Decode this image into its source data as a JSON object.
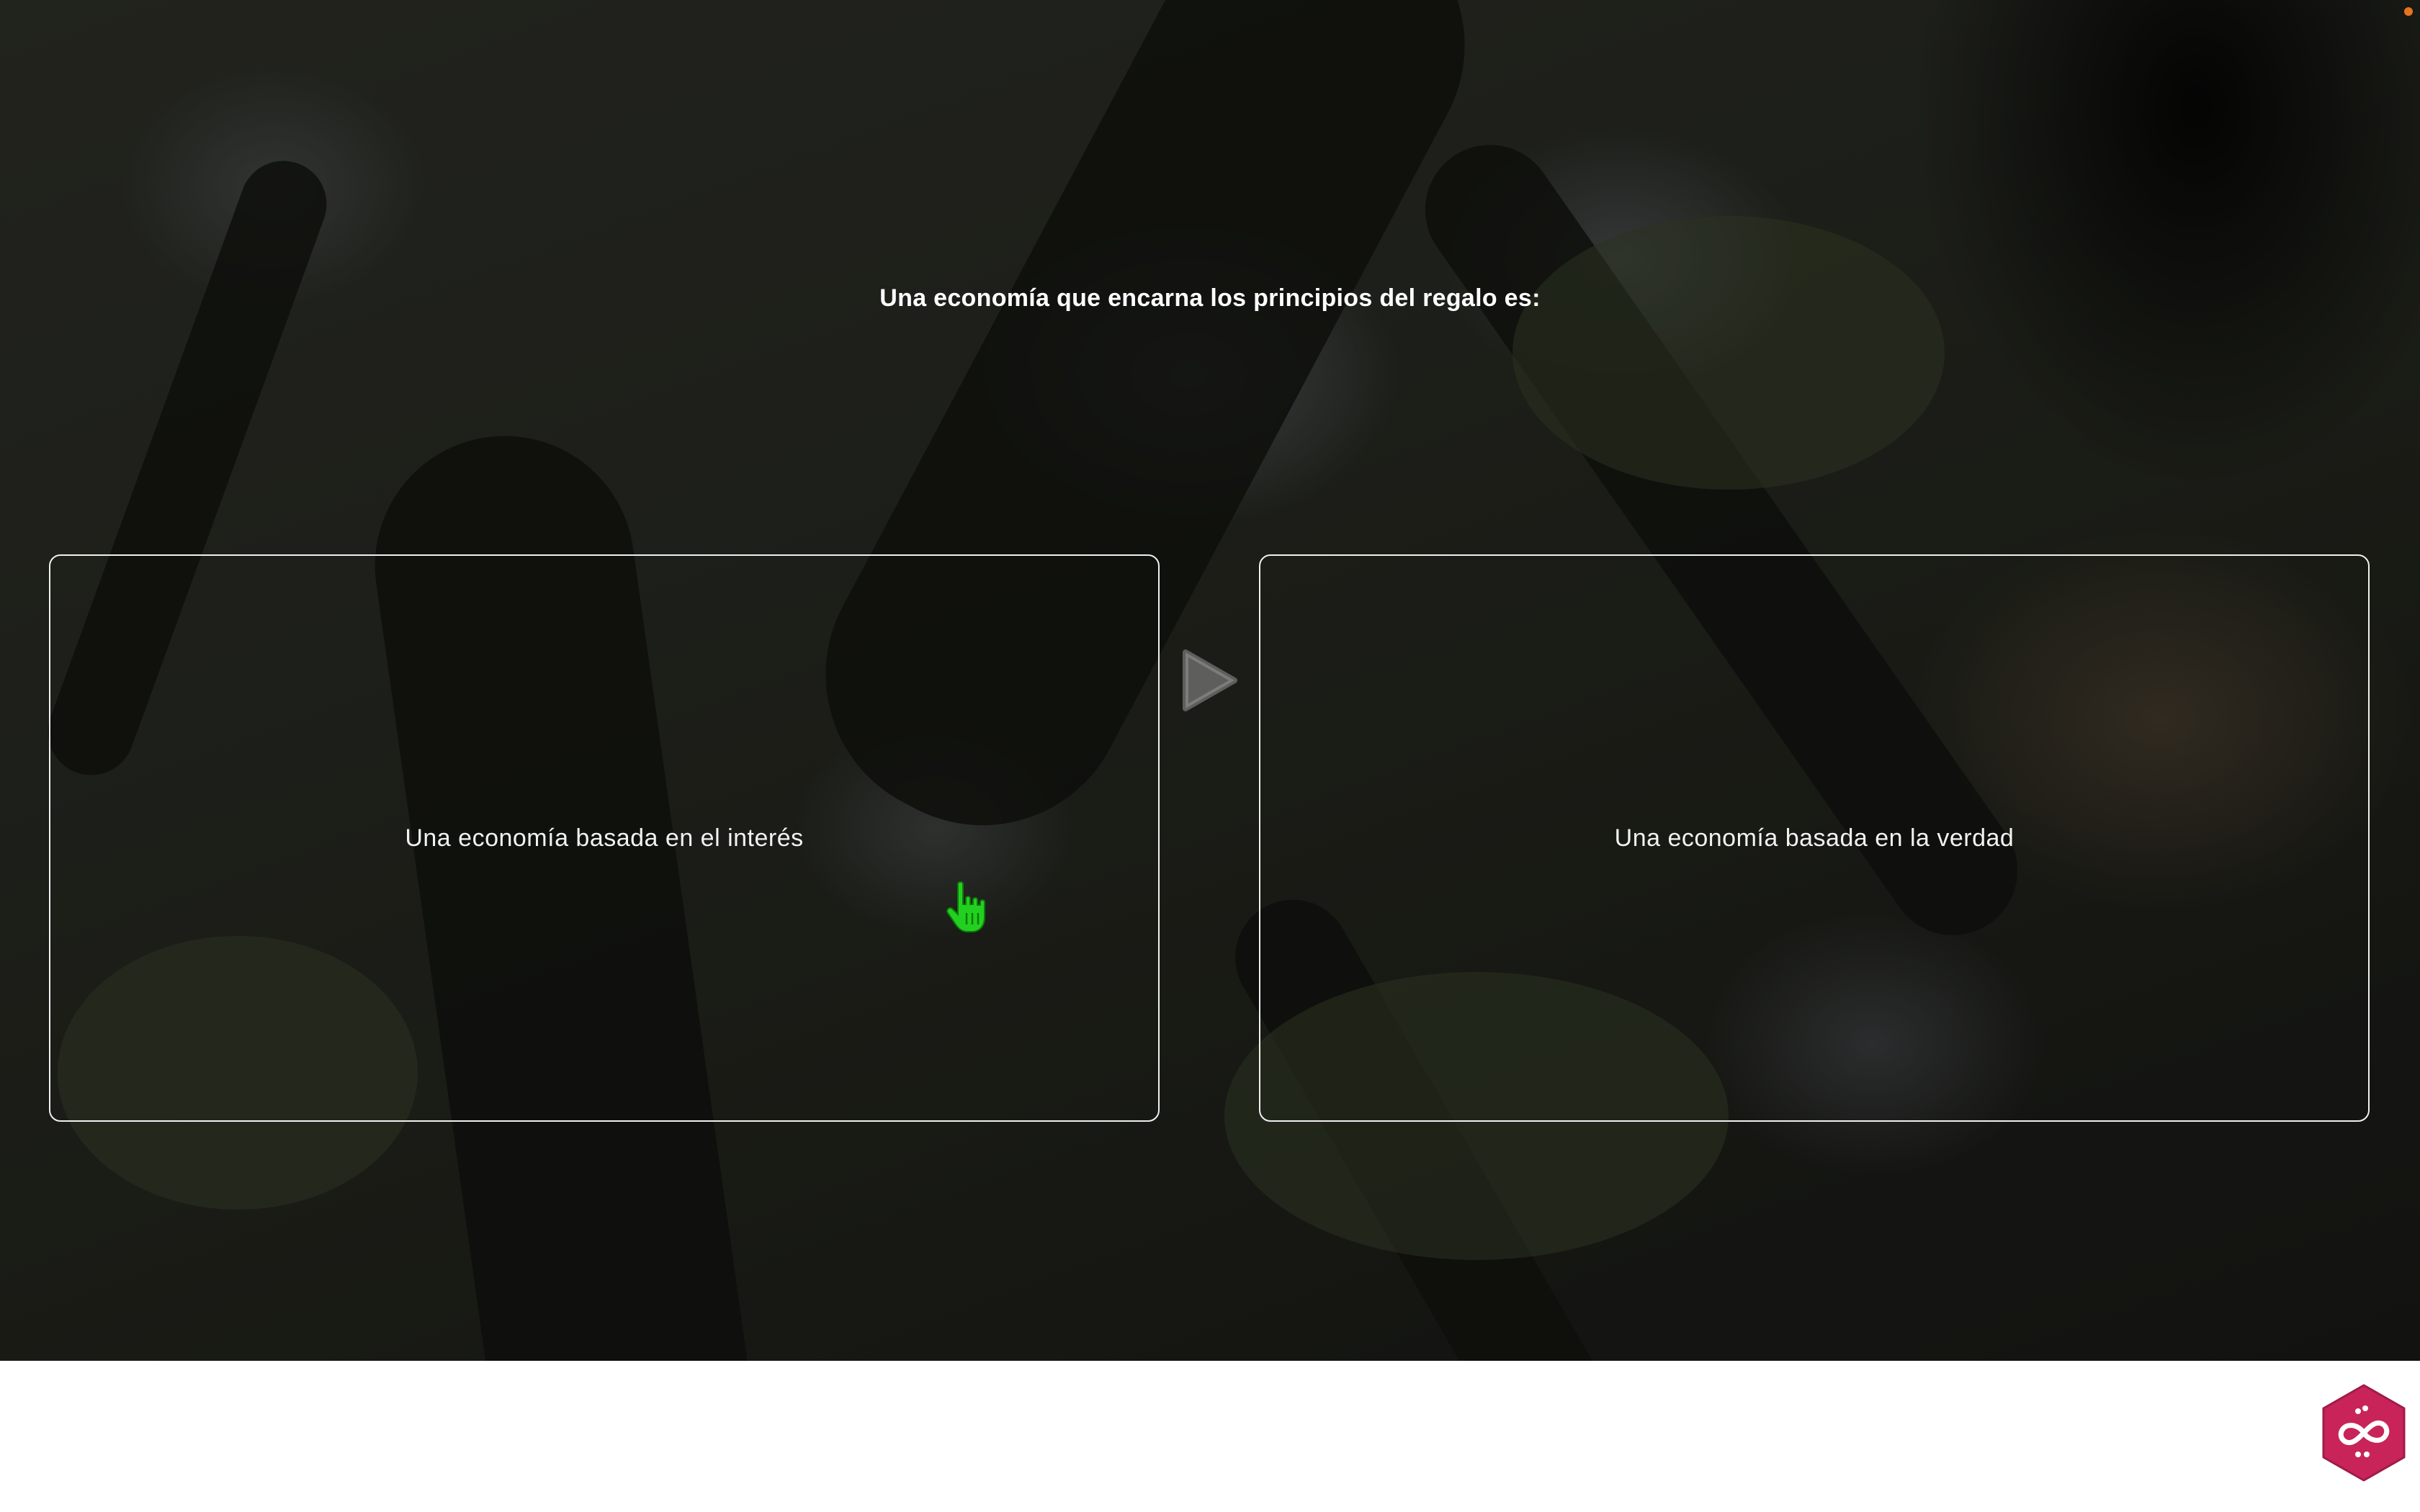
{
  "question": {
    "text": "Una economía que encarna los principios del regalo es:"
  },
  "options": [
    {
      "label": "Una economía basada en el interés"
    },
    {
      "label": "Una economía basada en la verdad"
    }
  ],
  "icons": {
    "play": "play-icon",
    "cursor": "hand-cursor-icon",
    "badge": "infinity-badge-icon",
    "recording": "recording-dot-icon"
  },
  "colors": {
    "cursor": "#22d11f",
    "badge": "#c8245a",
    "border": "#f0f0f0",
    "recording_dot": "#e5731f"
  }
}
